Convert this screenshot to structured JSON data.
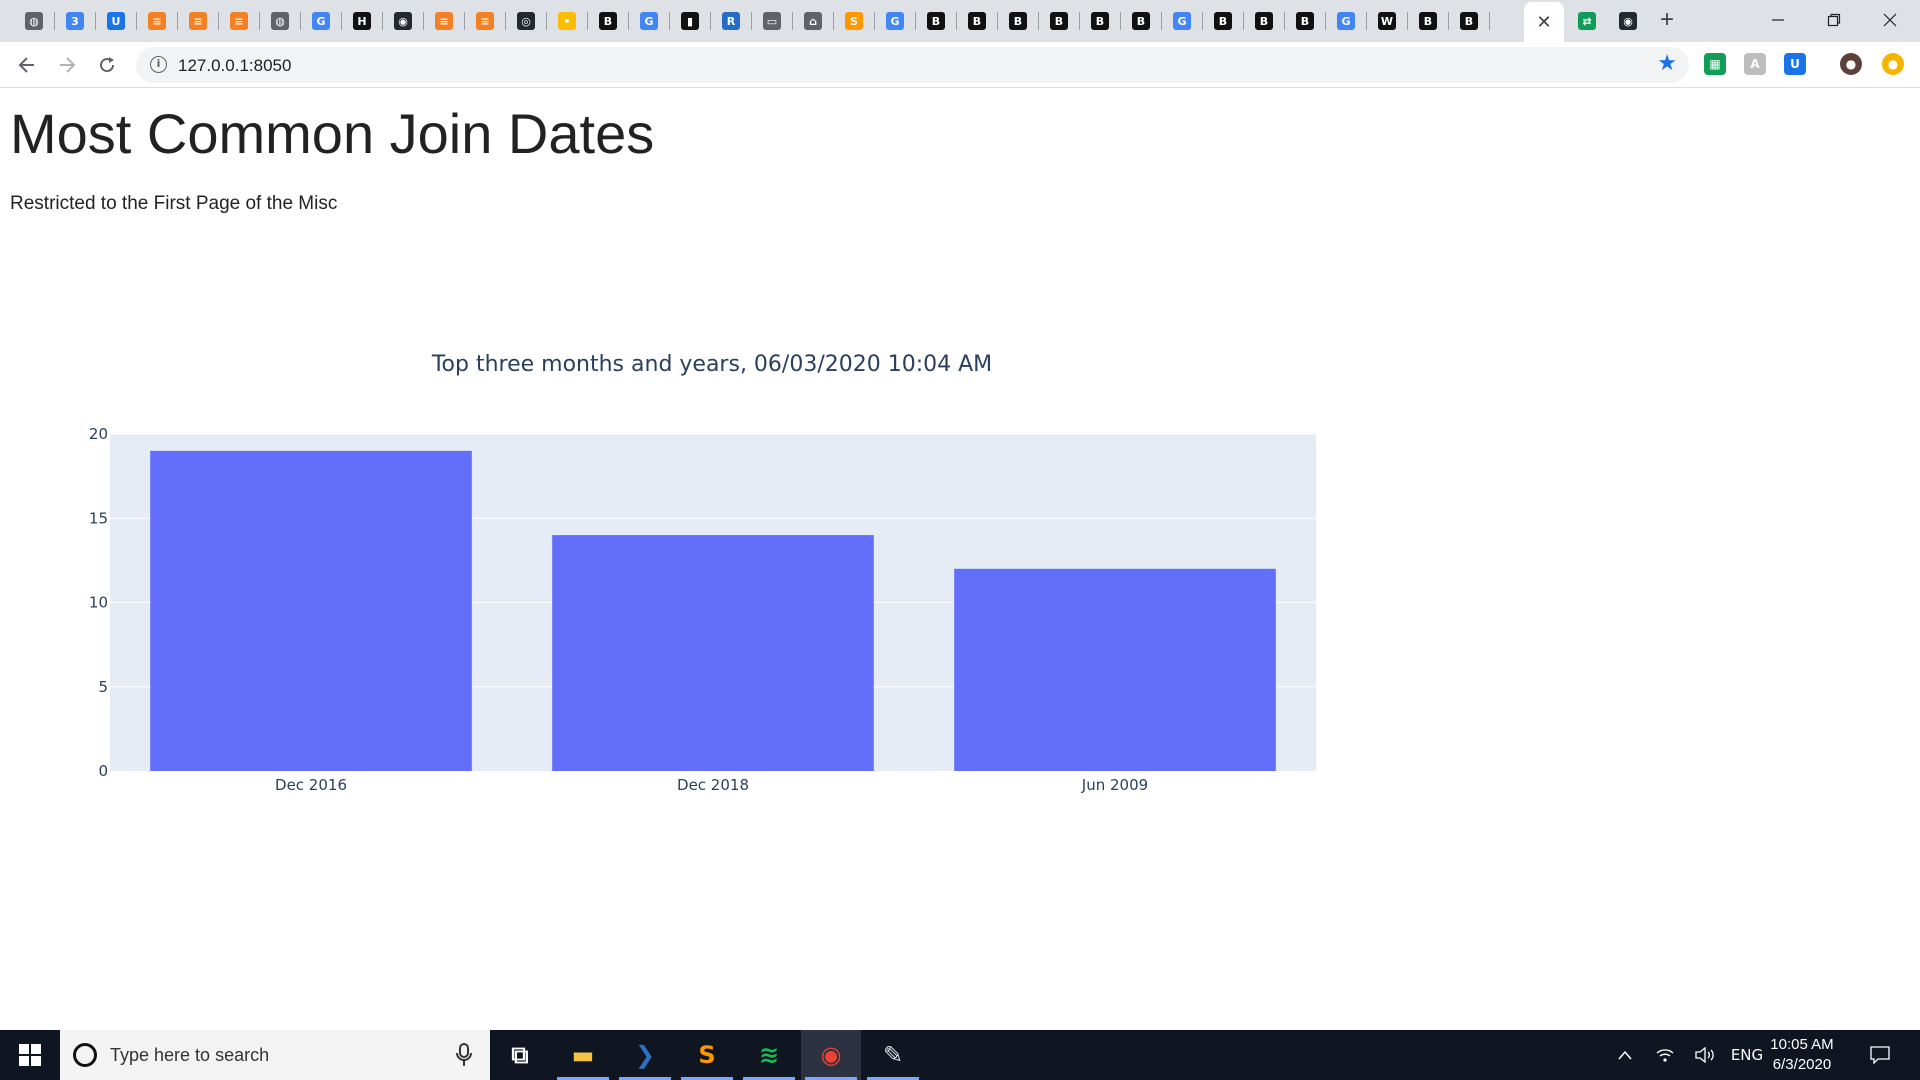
{
  "browser": {
    "url": "127.0.0.1:8050",
    "active_tab_close": "✕",
    "new_tab": "+",
    "tabs": [
      {
        "icon": "globe-icon",
        "glyph": "◍",
        "color": "#5f6368"
      },
      {
        "icon": "calendar-icon",
        "glyph": "3",
        "color": "#4285f4"
      },
      {
        "icon": "shield-u-icon",
        "glyph": "U",
        "color": "#1a73e8"
      },
      {
        "icon": "stackoverflow-icon",
        "glyph": "≡",
        "color": "#f48024"
      },
      {
        "icon": "stackoverflow-icon",
        "glyph": "≡",
        "color": "#f48024"
      },
      {
        "icon": "stackoverflow-icon",
        "glyph": "≡",
        "color": "#f48024"
      },
      {
        "icon": "globe-icon",
        "glyph": "◍",
        "color": "#5f6368"
      },
      {
        "icon": "google-icon",
        "glyph": "G",
        "color": "#4285f4"
      },
      {
        "icon": "hackerrank-icon",
        "glyph": "H",
        "color": "#111111"
      },
      {
        "icon": "github-icon",
        "glyph": "◉",
        "color": "#24292e"
      },
      {
        "icon": "stackoverflow-icon",
        "glyph": "≡",
        "color": "#f48024"
      },
      {
        "icon": "stackoverflow-icon",
        "glyph": "≡",
        "color": "#f48024"
      },
      {
        "icon": "target-icon",
        "glyph": "◎",
        "color": "#24292e"
      },
      {
        "icon": "pin-icon",
        "glyph": "•",
        "color": "#fbbc04"
      },
      {
        "icon": "b-icon",
        "glyph": "B",
        "color": "#111111"
      },
      {
        "icon": "google-icon",
        "glyph": "G",
        "color": "#4285f4"
      },
      {
        "icon": "file-icon",
        "glyph": "▮",
        "color": "#111111"
      },
      {
        "icon": "r-icon",
        "glyph": "R",
        "color": "#276dc3"
      },
      {
        "icon": "film-icon",
        "glyph": "▭",
        "color": "#5f6368"
      },
      {
        "icon": "bank-icon",
        "glyph": "⌂",
        "color": "#5f6368"
      },
      {
        "icon": "sublime-icon",
        "glyph": "S",
        "color": "#ff9800"
      },
      {
        "icon": "google-icon",
        "glyph": "G",
        "color": "#4285f4"
      },
      {
        "icon": "b-icon",
        "glyph": "B",
        "color": "#111111"
      },
      {
        "icon": "b-icon",
        "glyph": "B",
        "color": "#111111"
      },
      {
        "icon": "b-icon",
        "glyph": "B",
        "color": "#111111"
      },
      {
        "icon": "b-icon",
        "glyph": "B",
        "color": "#111111"
      },
      {
        "icon": "b-icon",
        "glyph": "B",
        "color": "#111111"
      },
      {
        "icon": "b-icon",
        "glyph": "B",
        "color": "#111111"
      },
      {
        "icon": "google-icon",
        "glyph": "G",
        "color": "#4285f4"
      },
      {
        "icon": "b-icon",
        "glyph": "B",
        "color": "#111111"
      },
      {
        "icon": "b-icon",
        "glyph": "B",
        "color": "#111111"
      },
      {
        "icon": "b-icon",
        "glyph": "B",
        "color": "#111111"
      },
      {
        "icon": "google-icon",
        "glyph": "G",
        "color": "#4285f4"
      },
      {
        "icon": "wikipedia-icon",
        "glyph": "W",
        "color": "#111111"
      },
      {
        "icon": "b-icon",
        "glyph": "B",
        "color": "#111111"
      },
      {
        "icon": "b-icon",
        "glyph": "B",
        "color": "#111111"
      }
    ],
    "after_active_tabs": [
      {
        "icon": "translate-icon",
        "glyph": "⇄",
        "color": "#0f9d58"
      },
      {
        "icon": "github-icon",
        "glyph": "◉",
        "color": "#24292e"
      }
    ],
    "extensions": [
      {
        "icon": "sheets-ext-icon",
        "glyph": "▦",
        "color": "#0f9d58"
      },
      {
        "icon": "puzzle-ext-icon",
        "glyph": "A",
        "color": "#bdbdbd"
      },
      {
        "icon": "shield-u-ext-icon",
        "glyph": "U",
        "color": "#1a73e8"
      },
      {
        "icon": "avatar-icon",
        "glyph": "●",
        "color": "#5d4037"
      },
      {
        "icon": "notification-ext-icon",
        "glyph": "●",
        "color": "#f4b400"
      }
    ]
  },
  "page": {
    "title": "Most Common Join Dates",
    "subtitle": "Restricted to the First Page of the Misc"
  },
  "chart_data": {
    "type": "bar",
    "title": "Top three months and years, 06/03/2020 10:04 AM",
    "categories": [
      "Dec 2016",
      "Dec 2018",
      "Jun 2009"
    ],
    "values": [
      19,
      14,
      12
    ],
    "ylim": [
      0,
      20
    ],
    "yticks": [
      0,
      5,
      10,
      15,
      20
    ],
    "xlabel": "",
    "ylabel": "",
    "grid": true,
    "bar_color": "#636efa",
    "plot_bg": "#e5ecf6"
  },
  "taskbar": {
    "search_placeholder": "Type here to search",
    "apps": [
      {
        "icon": "task-view-icon",
        "glyph": "⧉"
      },
      {
        "icon": "file-explorer-icon",
        "glyph": "▬"
      },
      {
        "icon": "powershell-icon",
        "glyph": "❯"
      },
      {
        "icon": "sublime-text-icon",
        "glyph": "S"
      },
      {
        "icon": "spotify-icon",
        "glyph": "≋"
      },
      {
        "icon": "chrome-icon",
        "glyph": "◉"
      },
      {
        "icon": "paint-icon",
        "glyph": "✎"
      }
    ],
    "tray_language": "ENG",
    "clock_time": "10:05 AM",
    "clock_date": "6/3/2020"
  }
}
